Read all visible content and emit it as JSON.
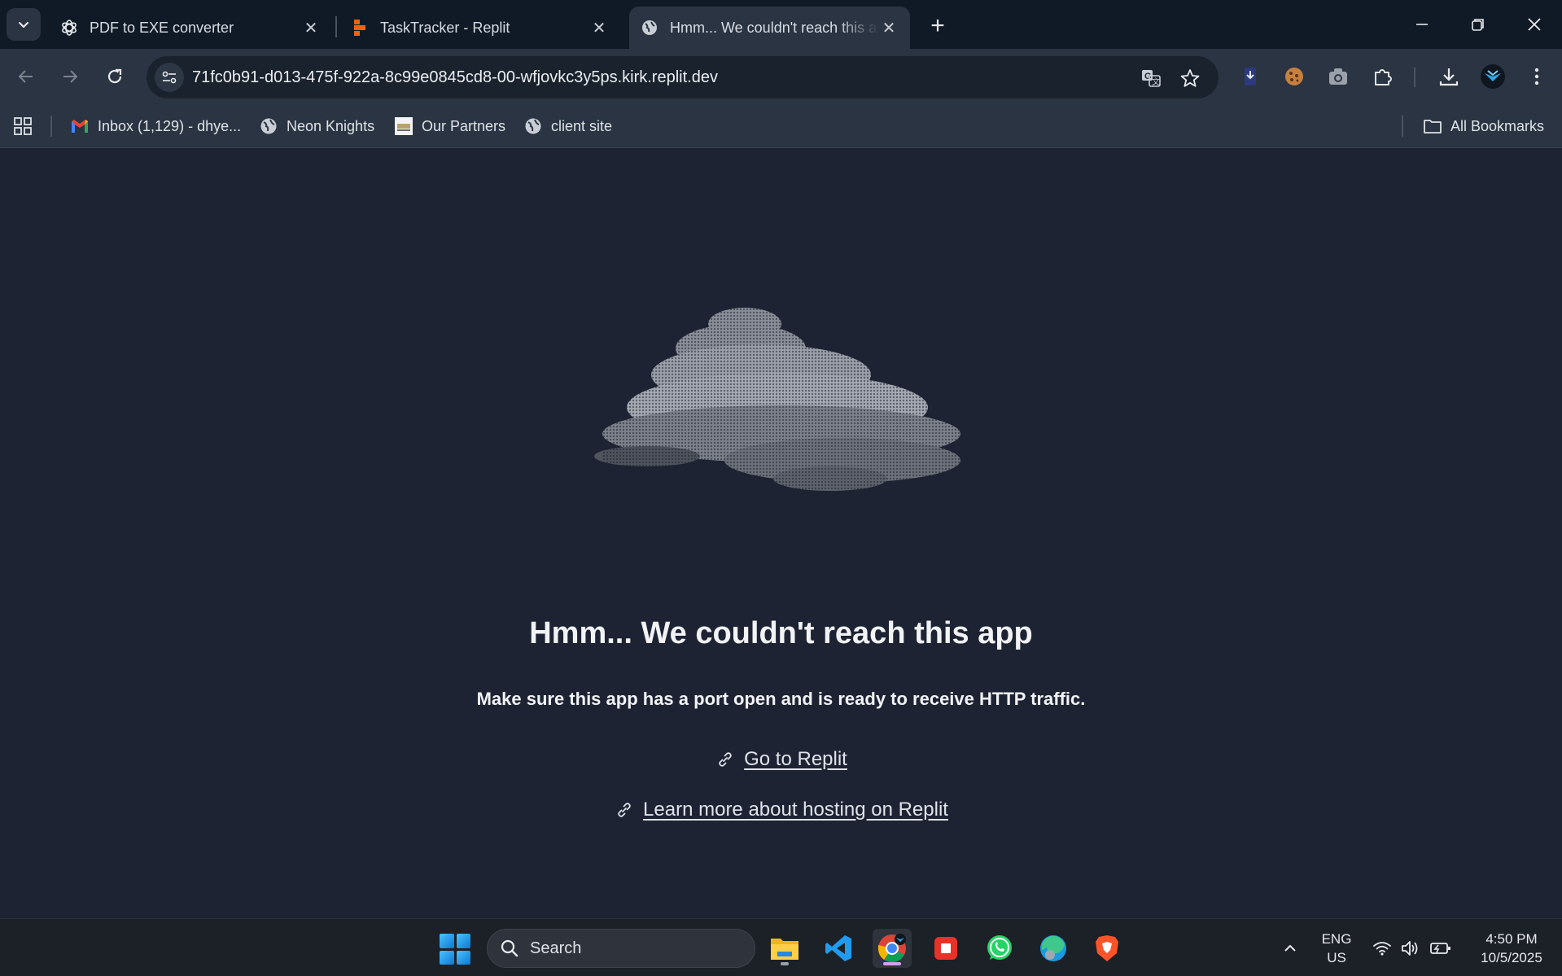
{
  "browser": {
    "tabs": [
      {
        "title": "PDF to EXE converter",
        "icon": "chatgpt-icon"
      },
      {
        "title": "TaskTracker - Replit",
        "icon": "replit-icon"
      },
      {
        "title": "Hmm... We couldn't reach this app",
        "icon": "globe-icon",
        "active": true
      }
    ],
    "url": "71fc0b91-d013-475f-922a-8c99e0845cd8-00-wfjovkc3y5ps.kirk.replit.dev",
    "bookmarks": [
      {
        "label": "Inbox (1,129) - dhye...",
        "icon": "gmail-icon"
      },
      {
        "label": "Neon Knights",
        "icon": "globe-icon"
      },
      {
        "label": "Our Partners",
        "icon": "site-favicon"
      },
      {
        "label": "client site",
        "icon": "globe-icon"
      }
    ],
    "all_bookmarks_label": "All Bookmarks"
  },
  "page": {
    "heading": "Hmm... We couldn't reach this app",
    "subtext": "Make sure this app has a port open and is ready to receive HTTP traffic.",
    "links": [
      {
        "label": "Go to Replit",
        "icon": "link-icon"
      },
      {
        "label": "Learn more about hosting on Replit",
        "icon": "link-icon"
      }
    ]
  },
  "taskbar": {
    "search_placeholder": "Search",
    "apps": [
      "file-explorer-icon",
      "vscode-icon",
      "chrome-icon",
      "red-app-icon",
      "whatsapp-icon",
      "edge-icon",
      "brave-icon"
    ],
    "language": {
      "line1": "ENG",
      "line2": "US"
    },
    "clock": {
      "time": "4:50 PM",
      "date": "10/5/2025"
    }
  },
  "colors": {
    "page_bg": "#1e2333",
    "tabstrip_bg": "#0f1a26",
    "toolbar_bg": "#2a3442",
    "taskbar_bg": "#1c2027"
  }
}
